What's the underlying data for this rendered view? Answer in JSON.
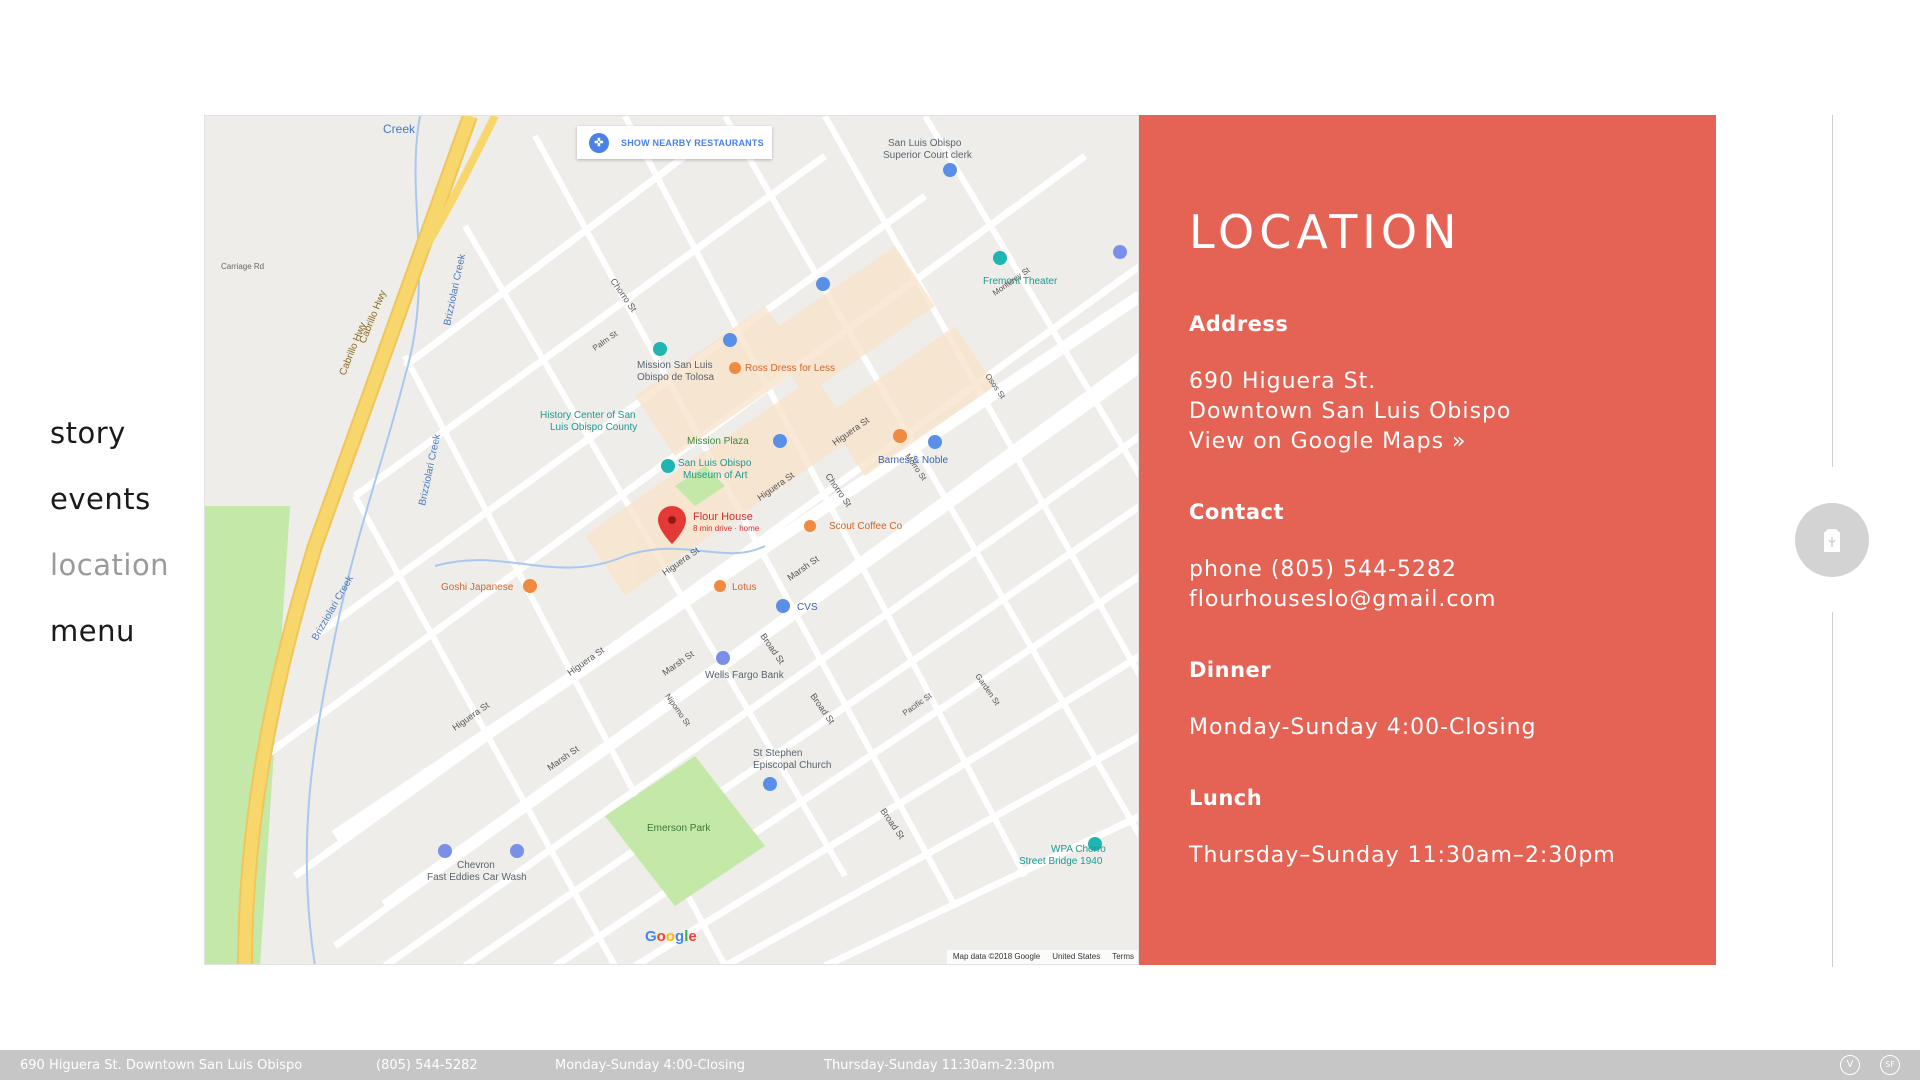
{
  "nav": {
    "items": [
      {
        "label": "story"
      },
      {
        "label": "events"
      },
      {
        "label": "location",
        "active": true
      },
      {
        "label": "menu"
      }
    ]
  },
  "map": {
    "button_label": "SHOW NEARBY RESTAURANTS",
    "marker_title": "Flour House",
    "marker_sub": "8 min drive · home",
    "attribution": [
      "Map data ©2018 Google",
      "United States",
      "Terms"
    ],
    "logo": "Google",
    "labels": {
      "cabrillo_hwy_1": "Cabrillo Hwy",
      "cabrillo_hwy_2": "Cabrillo Hwy",
      "brizziolari_1": "Brizziolari Creek",
      "brizziolari_2": "Brizziolari Creek",
      "brizziolari_3": "Brizziolari Creek",
      "creek": "Creek",
      "carriage_rd": "Carriage Rd",
      "mission": "Mission San Luis",
      "mission2": "Obispo de Tolosa",
      "history1": "History Center of San",
      "history2": "Luis Obispo County",
      "mission_plaza": "Mission Plaza",
      "museum1": "San Luis Obispo",
      "museum2": "Museum of Art",
      "ross": "Ross Dress for Less",
      "barnes": "Barnes & Noble",
      "scout": "Scout Coffee Co",
      "lotus": "Lotus",
      "cvs": "CVS",
      "goshi": "Goshi Japanese",
      "wells": "Wells Fargo Bank",
      "stephen1": "St Stephen",
      "stephen2": "Episcopal Church",
      "emerson": "Emerson Park",
      "chevron": "Chevron",
      "fasteddies": "Fast Eddies Car Wash",
      "fremont": "Fremont Theater",
      "court1": "San Luis Obispo",
      "court2": "Superior Court clerk",
      "wpa1": "WPA Chorro",
      "wpa2": "Street Bridge 1940",
      "higuera1": "Higuera St",
      "higuera2": "Higuera St",
      "higuera3": "Higuera St",
      "higuera4": "Higuera St",
      "higuera5": "Higuera St",
      "marsh1": "Marsh St",
      "marsh2": "Marsh St",
      "marsh3": "Marsh St",
      "chorro1": "Chorro St",
      "chorro2": "Chorro St",
      "broad1": "Broad St",
      "broad2": "Broad St",
      "broad3": "Broad St",
      "monterey": "Monterey St",
      "palm": "Palm St",
      "pacific": "Pacific St",
      "osos": "Osos St",
      "morro": "Morro St",
      "nipomo": "Nipomo St",
      "garden": "Garden St"
    }
  },
  "panel": {
    "title": "LOCATION",
    "address_heading": "Address",
    "address_line1": "690 Higuera St.",
    "address_line2": "Downtown San Luis Obispo",
    "maps_link": "View on Google Maps »",
    "contact_heading": "Contact",
    "phone": "phone (805) 544-5282",
    "email": "flourhouseslo@gmail.com",
    "dinner_heading": "Dinner",
    "dinner_hours": "Monday-Sunday 4:00-Closing",
    "lunch_heading": "Lunch",
    "lunch_hours": "Thursday–Sunday 11:30am–2:30pm"
  },
  "footer": {
    "address": "690 Higuera St. Downtown San Luis Obispo",
    "phone": "(805) 544-5282",
    "dinner": "Monday-Sunday 4:00-Closing",
    "lunch": "Thursday-Sunday 11:30am-2:30pm",
    "icon1": "V",
    "icon2": "SF"
  },
  "colors": {
    "panel": "#e46354",
    "footer": "#c6c6c6",
    "highway": "#f7d66b",
    "park": "#c3e8a8",
    "marker": "#e53935"
  }
}
